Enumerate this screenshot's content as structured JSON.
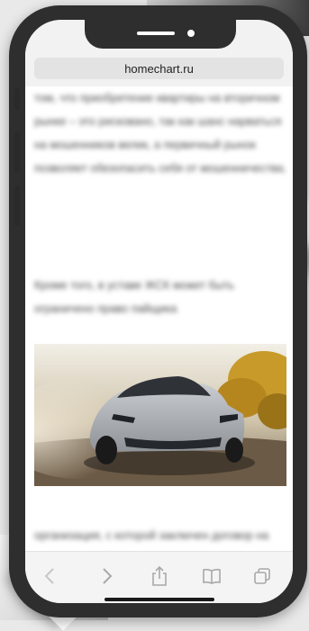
{
  "browser": {
    "url": "homechart.ru"
  },
  "article": {
    "paragraph_1": "том, что приобретение квартиры на вторичном рынке – это рисковано, так как шанс нарваться на мошенников велик, а первичный рынок позволяет обезопасить себя от мошенничества.",
    "paragraph_2": "Кроме того, в уставе ЖСК может быть ограничено право пайщика",
    "paragraph_3": "организация, с которой заключен договор на возведение объекта"
  },
  "toolbar": {
    "icons": [
      "back-icon",
      "forward-icon",
      "share-icon",
      "bookmarks-icon",
      "tabs-icon"
    ]
  },
  "colors": {
    "phone_frame": "#2e2e2e",
    "toolbar_icon": "#a8a8a8"
  }
}
